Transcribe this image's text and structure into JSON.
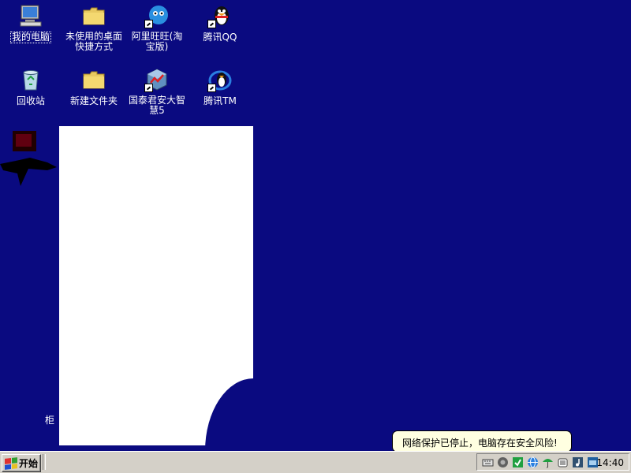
{
  "desktop": {
    "icons": [
      {
        "label": "我的电脑",
        "icon": "my-computer-icon"
      },
      {
        "label": "未使用的桌面快捷方式",
        "icon": "folder-icon"
      },
      {
        "label": "阿里旺旺(淘宝版)",
        "icon": "aliwangwang-icon"
      },
      {
        "label": "腾讯QQ",
        "icon": "qq-penguin-icon"
      },
      {
        "label": "回收站",
        "icon": "recycle-bin-icon"
      },
      {
        "label": "新建文件夹",
        "icon": "folder-icon"
      },
      {
        "label": "国泰君安大智慧5",
        "icon": "dazhihui-stock-icon"
      },
      {
        "label": "腾讯TM",
        "icon": "tencent-tm-icon"
      }
    ],
    "partial_label": "柜"
  },
  "taskbar": {
    "start_label": "开始",
    "tray_icons": [
      "keyboard-icon",
      "speaker-icon",
      "green-shield-icon",
      "network-globe-icon",
      "umbrella-icon",
      "antivirus-icon",
      "music-icon",
      "ime-icon"
    ],
    "clock": "14:40"
  },
  "balloon": {
    "text": "网络保护已停止，电脑存在安全风险!"
  },
  "colors": {
    "desktop": "#0a0a80",
    "taskbar": "#d4d0c8",
    "balloon": "#ffffe1"
  }
}
